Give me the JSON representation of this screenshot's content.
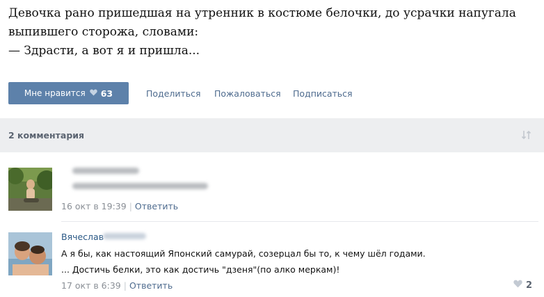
{
  "post": {
    "lines": [
      "Девочка рано пришедшая на утренник в костюме белочки, до усрачки напугала",
      "выпившего сторожа, словами:",
      "— Здрасти, а вот я и пришла..."
    ]
  },
  "actions": {
    "like_label": "Мне нравится",
    "like_count": "63",
    "share": "Поделиться",
    "report": "Пожаловаться",
    "subscribe": "Подписаться"
  },
  "comments_header": {
    "title": "2 комментария",
    "sort_icon": "sort-arrows-icon"
  },
  "comments": [
    {
      "avatar": "user-photo",
      "author": "",
      "text_lines": [],
      "date": "16 окт в 19:39",
      "reply": "Ответить"
    },
    {
      "avatar": "user-photo",
      "author": "Вячеслав",
      "text_lines": [
        "А я бы, как настоящий Японский самурай, созерцал бы то, к чему шёл годами.",
        "... Достичь белки, это как достичь \"дзеня\"(по алко меркам)!"
      ],
      "date": "17 окт в 6:39",
      "reply": "Ответить",
      "likes": "2"
    }
  ],
  "colors": {
    "accent": "#5d81aa",
    "link": "#4e6b8e",
    "header_bg": "#edeef0"
  }
}
